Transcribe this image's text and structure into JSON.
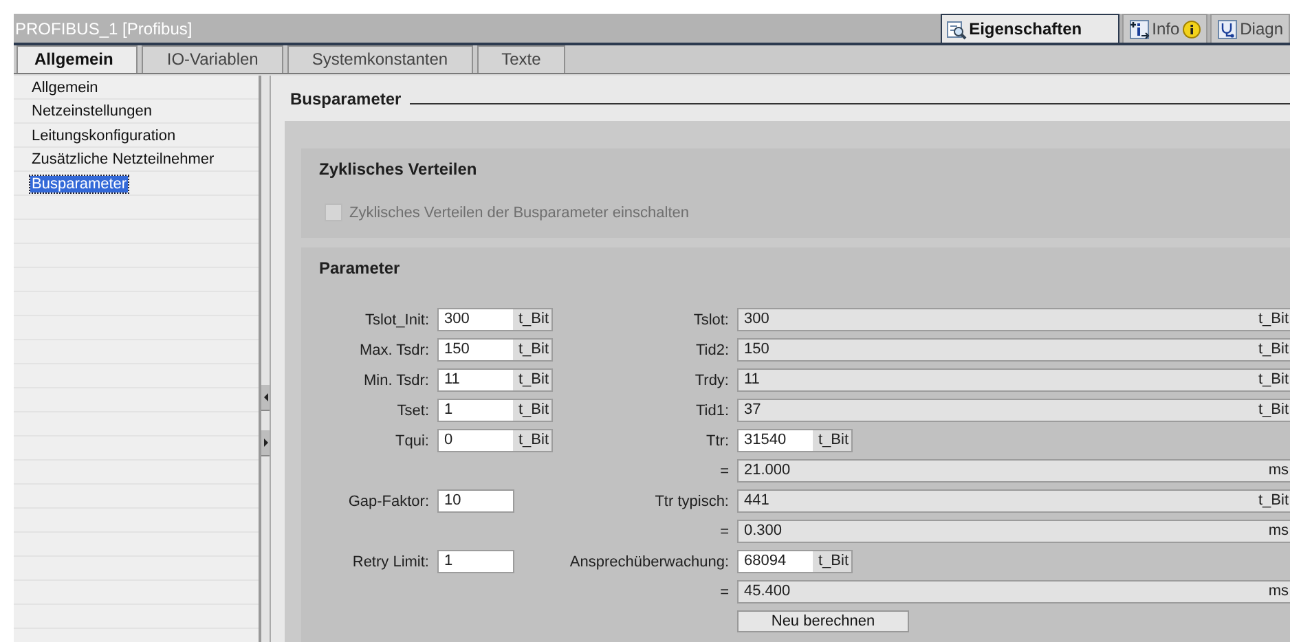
{
  "window": {
    "title": "PROFIBUS_1 [Profibus]"
  },
  "inspector_tabs": [
    {
      "label": "Eigenschaften",
      "selected": true,
      "kind": "properties",
      "badge": false
    },
    {
      "label": "Info",
      "selected": false,
      "kind": "info",
      "badge": true
    },
    {
      "label": "Diagn",
      "selected": false,
      "kind": "diagnostics",
      "badge": false
    }
  ],
  "tabs": [
    {
      "label": "Allgemein",
      "selected": true
    },
    {
      "label": "IO-Variablen",
      "selected": false
    },
    {
      "label": "Systemkonstanten",
      "selected": false
    },
    {
      "label": "Texte",
      "selected": false
    }
  ],
  "sidebar": {
    "items": [
      {
        "label": "Allgemein",
        "selected": false
      },
      {
        "label": "Netzeinstellungen",
        "selected": false
      },
      {
        "label": "Leitungskonfiguration",
        "selected": false
      },
      {
        "label": "Zusätzliche Netzteilnehmer",
        "selected": false
      },
      {
        "label": "Busparameter",
        "selected": true
      }
    ]
  },
  "section_title": "Busparameter",
  "cyclic_group": {
    "title": "Zyklisches Verteilen",
    "checkbox": {
      "label": "Zyklisches Verteilen der Busparameter einschalten",
      "checked": false,
      "disabled": true
    }
  },
  "parameter_group": {
    "title": "Parameter",
    "rows": [
      {
        "left": {
          "label": "Tslot_Init:",
          "value": "300",
          "unit": "t_Bit"
        },
        "right": {
          "label": "Tslot:",
          "value": "300",
          "unit": "t_Bit",
          "kind": "readonly"
        }
      },
      {
        "left": {
          "label": "Max. Tsdr:",
          "value": "150",
          "unit": "t_Bit"
        },
        "right": {
          "label": "Tid2:",
          "value": "150",
          "unit": "t_Bit",
          "kind": "readonly"
        }
      },
      {
        "left": {
          "label": "Min. Tsdr:",
          "value": "11",
          "unit": "t_Bit"
        },
        "right": {
          "label": "Trdy:",
          "value": "11",
          "unit": "t_Bit",
          "kind": "readonly"
        }
      },
      {
        "left": {
          "label": "Tset:",
          "value": "1",
          "unit": "t_Bit"
        },
        "right": {
          "label": "Tid1:",
          "value": "37",
          "unit": "t_Bit",
          "kind": "readonly"
        }
      },
      {
        "left": {
          "label": "Tqui:",
          "value": "0",
          "unit": "t_Bit"
        },
        "right": {
          "label": "Ttr:",
          "value": "31540",
          "unit": "t_Bit",
          "kind": "input"
        }
      },
      {
        "right": {
          "label": "=",
          "value": "21.000",
          "unit": "ms",
          "kind": "readonly"
        }
      },
      {
        "left": {
          "label": "Gap-Faktor:",
          "value": "10"
        },
        "right": {
          "label": "Ttr typisch:",
          "value": "441",
          "unit": "t_Bit",
          "kind": "readonly"
        }
      },
      {
        "right": {
          "label": "=",
          "value": "0.300",
          "unit": "ms",
          "kind": "readonly"
        }
      },
      {
        "left": {
          "label": "Retry Limit:",
          "value": "1"
        },
        "right": {
          "label": "Ansprechüberwachung:",
          "value": "68094",
          "unit": "t_Bit",
          "kind": "input"
        }
      },
      {
        "right": {
          "label": "=",
          "value": "45.400",
          "unit": "ms",
          "kind": "readonly"
        }
      }
    ],
    "button": "Neu berechnen"
  }
}
